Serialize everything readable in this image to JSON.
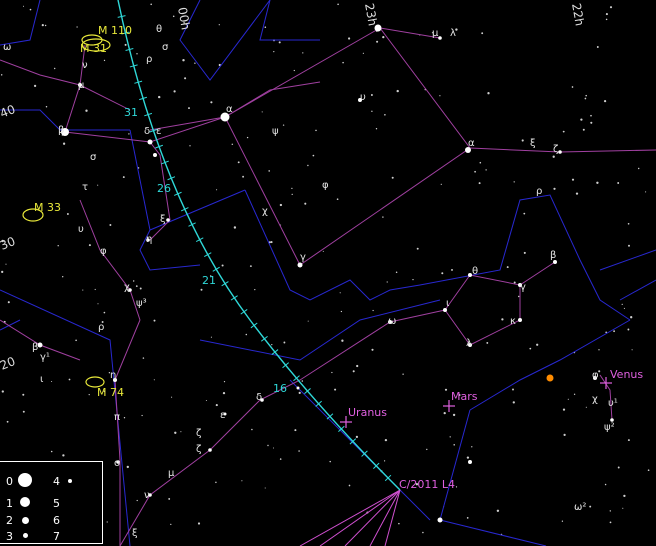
{
  "chart_data": {
    "type": "star-chart",
    "constellation_greek_labels": [
      "ω",
      "ν",
      "μ",
      "β",
      "σ",
      "τ",
      "υ",
      "φ",
      "χ",
      "ψ³",
      "ρ",
      "β",
      "γ¹",
      "ι",
      "η",
      "π",
      "o",
      "ν",
      "μ",
      "ζ",
      "ζ",
      "ε",
      "δ",
      "ξ",
      "θ",
      "ρ",
      "σ",
      "α",
      "ψ",
      "φ",
      "χ",
      "γ",
      "υ",
      "α",
      "ξ",
      "ζ",
      "μ",
      "λ",
      "ρ",
      "θ",
      "β",
      "γ",
      "ι",
      "ω",
      "κ",
      "λ",
      "φ",
      "χ",
      "υ¹",
      "ψ²",
      "ω²",
      "ε",
      "δ",
      "η",
      "ξ"
    ],
    "coordinate_labels": [
      "40",
      "30",
      "20",
      "00h",
      "23h",
      "22h"
    ],
    "ecliptic_day_marks": [
      "31",
      "26",
      "21",
      "16"
    ],
    "deep_sky_objects": [
      "M 110",
      "M 31",
      "M 33",
      "M 74"
    ],
    "planets": [
      "Venus",
      "Mars",
      "Uranus"
    ],
    "comet": "C/2011 L4"
  },
  "legend": {
    "magnitudes": [
      "0",
      "1",
      "2",
      "3",
      "4",
      "5",
      "6",
      "7"
    ]
  },
  "colors": {
    "background": "#000000",
    "constellation_lines": "#a040a0",
    "boundaries": "#2828d0",
    "ecliptic_path": "#2fd8d8",
    "deep_sky": "#e8e83a",
    "planets": "#e060e0",
    "sun": "#ff8c00"
  }
}
